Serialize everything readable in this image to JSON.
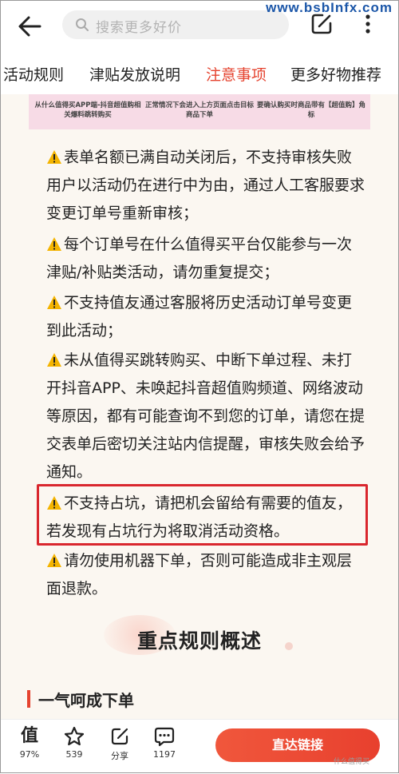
{
  "header": {
    "search_placeholder": "搜索更多好价",
    "watermark": "www.bsbInfx.com"
  },
  "tabs": [
    {
      "label": "活动规则"
    },
    {
      "label": "津贴发放说明"
    },
    {
      "label": "注意事项",
      "active": true
    },
    {
      "label": "更多好物推荐"
    }
  ],
  "banner": {
    "captions": [
      "从什么值得买APP端-抖音超值购相关爆料跳转购买",
      "正常情况下会进入上方页面点击目标商品下单",
      "要确认购买时商品带有【超值购】角标"
    ]
  },
  "notes": [
    {
      "lines": [
        "表单名额已满自动关闭后，不支持审核失败",
        "用户以活动仍在进行中为由，通过人工客服要求",
        "变更订单号重新审核；"
      ]
    },
    {
      "lines": [
        "每个订单号在什么值得买平台仅能参与一次",
        "津贴/补贴类活动，请勿重复提交；"
      ]
    },
    {
      "lines": [
        "不支持值友通过客服将历史活动订单号变更",
        "到此活动；"
      ]
    },
    {
      "lines": [
        "未从值得买跳转购买、中断下单过程、未打",
        "开抖音APP、未唤起抖音超值购频道、网络波动",
        "等原因，都有可能查询不到您的订单，请您在提",
        "交表单后密切关注站内信提醒，审核失败会给予",
        "通知。"
      ]
    },
    {
      "lines": [
        "不支持占坑，请把机会留给有需要的值友，",
        "若发现有占坑行为将取消活动资格。"
      ]
    },
    {
      "lines": [
        "请勿使用机器下单，否则可能造成非主观层",
        "面退款。"
      ]
    }
  ],
  "section": {
    "title": "重点规则概述",
    "subtitle": "一气呵成下单"
  },
  "bottom_bar": {
    "worth": {
      "icon": "worth-icon",
      "glyph": "值",
      "label": "97%"
    },
    "favorite": {
      "icon": "star-icon",
      "label": "539"
    },
    "share": {
      "icon": "share-icon",
      "label": "分享"
    },
    "comment": {
      "icon": "comment-icon",
      "label": "1197"
    },
    "cta_label": "直达链接",
    "brand": "什么值得买"
  },
  "colors": {
    "accent": "#e5432f",
    "highlight_border": "#d9272e",
    "warning": "#f4b400",
    "background": "#fbf7f1"
  }
}
